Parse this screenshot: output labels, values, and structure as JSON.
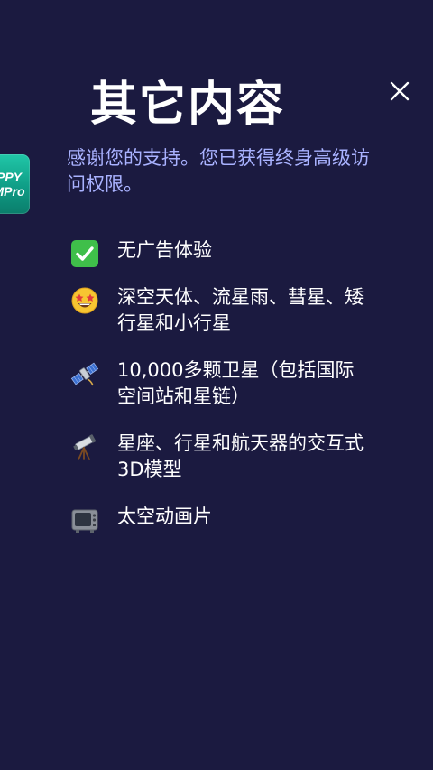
{
  "header": {
    "title": "其它内容"
  },
  "badge": {
    "line1": "PPY",
    "line2": "MPro"
  },
  "subtitle": "感谢您的支持。您已获得终身高级访问权限。",
  "features": [
    {
      "icon": "check-mark-icon",
      "label": "无广告体验"
    },
    {
      "icon": "star-struck-emoji-icon",
      "label": "深空天体、流星雨、彗星、矮行星和小行星"
    },
    {
      "icon": "satellite-icon",
      "label": "10,000多颗卫星（包括国际空间站和星链）"
    },
    {
      "icon": "telescope-icon",
      "label": "星座、行星和航天器的交互式3D模型"
    },
    {
      "icon": "television-icon",
      "label": "太空动画片"
    }
  ],
  "colors": {
    "background": "#1b1a40",
    "subtitle": "#a9b2ff",
    "check": "#3fbf4a",
    "badge": "#16a890"
  }
}
